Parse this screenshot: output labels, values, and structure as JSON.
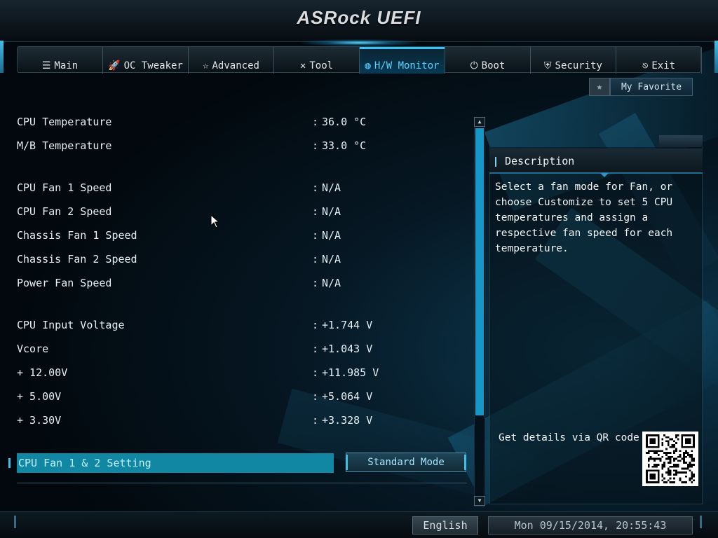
{
  "header": {
    "logo": "ASRock UEFI"
  },
  "tabs": [
    {
      "icon": "☰",
      "icon_name": "list-icon",
      "label": "Main",
      "active": false
    },
    {
      "icon": "🚀",
      "icon_name": "rocket-icon",
      "label": "OC Tweaker",
      "active": false
    },
    {
      "icon": "☆",
      "icon_name": "star-icon",
      "label": "Advanced",
      "active": false
    },
    {
      "icon": "✕",
      "icon_name": "tools-icon",
      "label": "Tool",
      "active": false
    },
    {
      "icon": "◍",
      "icon_name": "monitor-icon",
      "label": "H/W Monitor",
      "active": true
    },
    {
      "icon": "⏻",
      "icon_name": "power-icon",
      "label": "Boot",
      "active": false
    },
    {
      "icon": "⛨",
      "icon_name": "shield-icon",
      "label": "Security",
      "active": false
    },
    {
      "icon": "⎋",
      "icon_name": "exit-icon",
      "label": "Exit",
      "active": false
    }
  ],
  "favorite": {
    "star": "★",
    "label": "My Favorite"
  },
  "readings": [
    {
      "label": "CPU Temperature",
      "value": "36.0 °C"
    },
    {
      "label": "M/B Temperature",
      "value": "33.0 °C"
    },
    {
      "label": "CPU Fan 1 Speed",
      "value": "N/A"
    },
    {
      "label": "CPU Fan 2 Speed",
      "value": "N/A"
    },
    {
      "label": "Chassis Fan 1 Speed",
      "value": "N/A"
    },
    {
      "label": "Chassis Fan 2 Speed",
      "value": "N/A"
    },
    {
      "label": "Power Fan Speed",
      "value": "N/A"
    },
    {
      "label": "CPU Input Voltage",
      "value": "+1.744 V"
    },
    {
      "label": "Vcore",
      "value": "+1.043 V"
    },
    {
      "label": "+ 12.00V",
      "value": "+11.985 V"
    },
    {
      "label": "+ 5.00V",
      "value": "+5.064 V"
    },
    {
      "label": "+ 3.30V",
      "value": "+3.328 V"
    }
  ],
  "colon": ":",
  "setting": {
    "label": "CPU Fan 1 & 2 Setting",
    "value": "Standard Mode"
  },
  "description": {
    "title": "Description",
    "text": "Select a fan mode for Fan, or choose Customize to set 5 CPU temperatures and assign a respective fan speed for each temperature.",
    "qr_label": "Get details via QR code"
  },
  "footer": {
    "language": "English",
    "datetime": "Mon 09/15/2014, 20:55:43"
  },
  "colors": {
    "accent": "#3cc0f5",
    "selected_row": "#1287a4"
  }
}
